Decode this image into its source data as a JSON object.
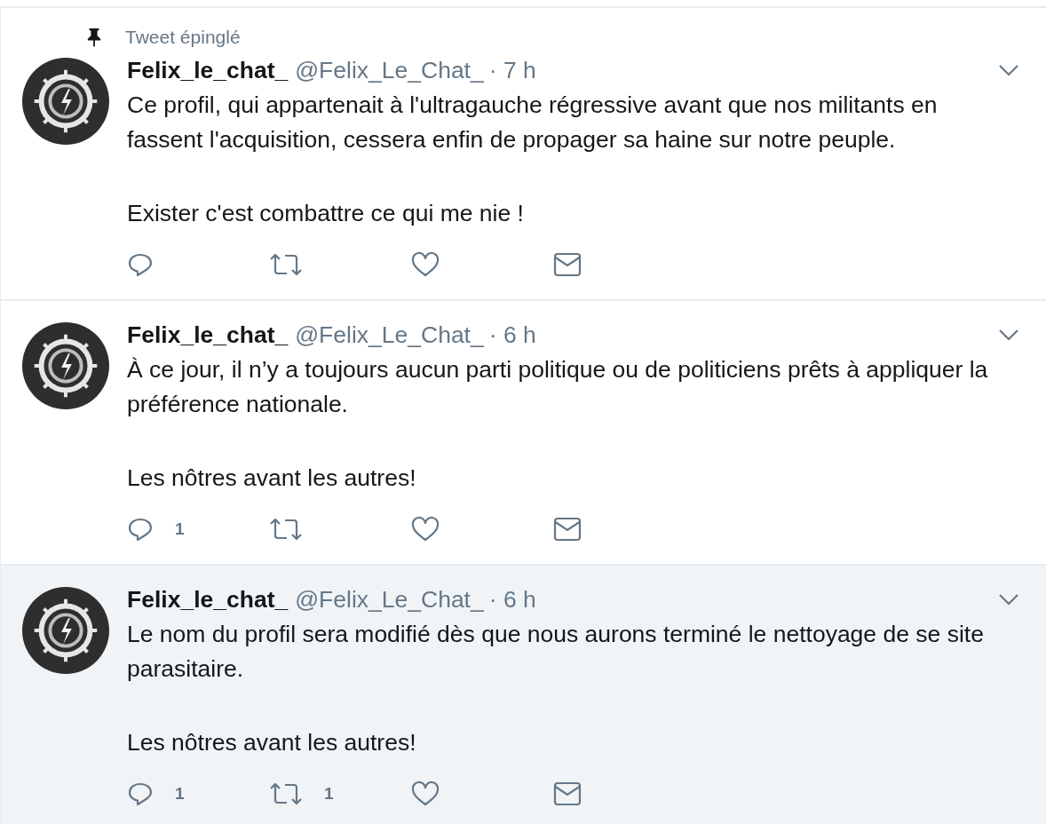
{
  "tweets": [
    {
      "pinned_label": "Tweet épinglé",
      "name": "Felix_le_chat_",
      "handle": "@Felix_Le_Chat_",
      "time": "· 7 h",
      "highlighted": false,
      "paragraphs": [
        "Ce profil, qui appartenait à l'ultragauche régressive avant que nos militants en fassent l'acquisition, cessera enfin de propager sa haine sur notre peuple.",
        "Exister c'est combattre ce qui me nie !"
      ],
      "actions": [
        {
          "kind": "reply"
        },
        {
          "kind": "retweet"
        },
        {
          "kind": "like"
        },
        {
          "kind": "message"
        }
      ]
    },
    {
      "name": "Felix_le_chat_",
      "handle": "@Felix_Le_Chat_",
      "time": "· 6 h",
      "highlighted": false,
      "paragraphs": [
        "À ce jour, il n’y a toujours aucun parti politique ou de politiciens prêts à appliquer la préférence nationale.",
        "Les nôtres avant les autres!"
      ],
      "actions": [
        {
          "kind": "reply",
          "count": "1"
        },
        {
          "kind": "retweet"
        },
        {
          "kind": "like"
        },
        {
          "kind": "message"
        }
      ]
    },
    {
      "name": "Felix_le_chat_",
      "handle": "@Felix_Le_Chat_",
      "time": "· 6 h",
      "highlighted": true,
      "paragraphs": [
        "Le nom du profil sera modifié dès que nous aurons terminé le nettoyage de se site parasitaire.",
        "Les nôtres avant les autres!"
      ],
      "actions": [
        {
          "kind": "reply",
          "count": "1"
        },
        {
          "kind": "retweet",
          "count": "1"
        },
        {
          "kind": "like"
        },
        {
          "kind": "message"
        }
      ]
    }
  ]
}
